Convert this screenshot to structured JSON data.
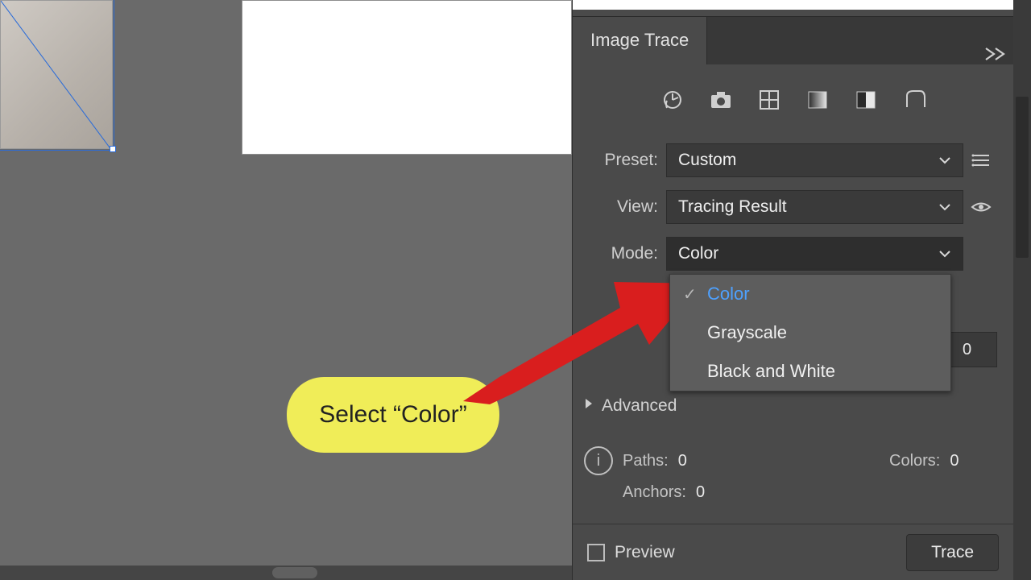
{
  "panel": {
    "title": "Image Trace",
    "preset_icons": [
      "auto-color-icon",
      "camera-icon",
      "grid-icon",
      "gradient-icon",
      "bw-icon",
      "outline-icon"
    ],
    "preset": {
      "label": "Preset:",
      "value": "Custom"
    },
    "view": {
      "label": "View:",
      "value": "Tracing Result"
    },
    "mode": {
      "label": "Mode:",
      "value": "Color",
      "options": [
        "Color",
        "Grayscale",
        "Black and White"
      ],
      "selected_index": 0
    },
    "hidden_value": "0",
    "advanced": {
      "label": "Advanced"
    },
    "stats": {
      "paths": {
        "label": "Paths:",
        "value": "0"
      },
      "colors": {
        "label": "Colors:",
        "value": "0"
      },
      "anchors": {
        "label": "Anchors:",
        "value": "0"
      }
    },
    "preview": {
      "label": "Preview",
      "checked": false
    },
    "trace": {
      "label": "Trace"
    }
  },
  "annotation": {
    "callout_text": "Select “Color”"
  }
}
